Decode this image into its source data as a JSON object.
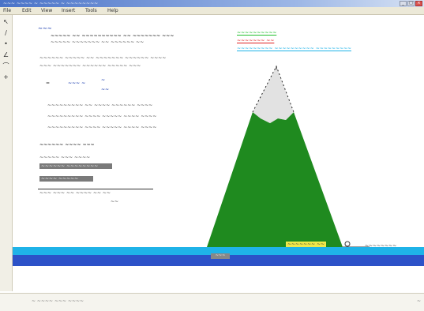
{
  "window": {
    "title": "~~~ ~~~~ ~ ~~~~~ ~ ~~~~~~~~",
    "min": "_",
    "max": "□",
    "close": "×"
  },
  "menu": [
    "File",
    "Edit",
    "View",
    "Insert",
    "Tools",
    "Help"
  ],
  "tools": [
    "↖",
    "∕",
    "•",
    "∠",
    "⌒",
    "+"
  ],
  "content": {
    "heading": "~~~",
    "intro_line1": "~~~~~ ~~ ~~~~~~~~~~ ~~ ~~~~~~~ ~~~",
    "intro_line2": "~~~~~ ~~~~~~~ ~~ ~~~~~~ ~~",
    "para_line1": "~~~~~~ ~~~~~ ~~ ~~~~~~~ ~~~~~~ ~~~~",
    "para_line2": "~~~ ~~~~~~~ ~~~~~~ ~~~~~ ~~~",
    "formula_left": "=",
    "formula_mid": "~~~ ~",
    "formula_right": "~",
    "formula_den": "~~",
    "step1": "~~~~~~~~~ ~~ ~~~~ ~~~~~~ ~~~~",
    "step2": "~~~~~~~~~ ~~~~ ~~~~~ ~~~~ ~~~~",
    "step3": "~~~~~~~~~ ~~~~ ~~~~~ ~~~~ ~~~~",
    "result_label": "~~~~~~ ~~~~ ~~~",
    "result_line": "~~~~~ ~~~ ~~~~",
    "button1": "~~~~~~ ~~~~~~~~",
    "button2": "~~~~ ~~~~~",
    "bottom_text": "~~~ ~~~ ~~ ~~~~ ~~ ~~",
    "bottom_sub": "~~"
  },
  "legend": {
    "green_label": "~~~~~~~~~~",
    "red_label": "~~~~~~~ ~~",
    "cyan_label": "~~~~~~~~~ ~~~~~~~~~~ ~~~~~~~~~"
  },
  "scene": {
    "ground_label": "~~~",
    "marker_label": "~~~~~~~ ~~",
    "marker_right": "~~~~~~~~",
    "colors": {
      "mountain": "#1f8a1f",
      "snow": "#e2e2e2",
      "water": "#1fb3e8",
      "ground": "#2c52c8"
    }
  },
  "status": {
    "text": "~ ~~~~ ~~~ ~~~~",
    "corner": "~"
  }
}
